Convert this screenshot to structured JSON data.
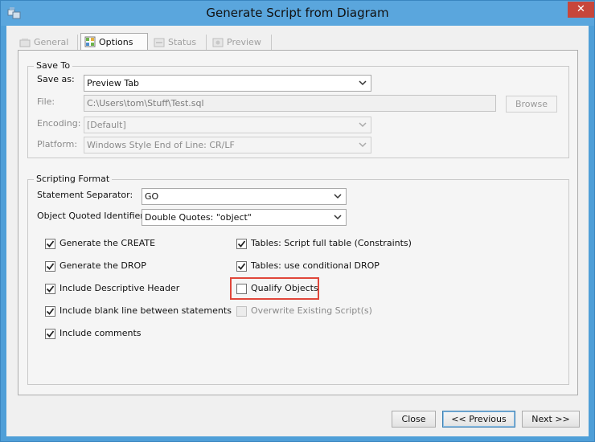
{
  "window": {
    "title": "Generate Script from Diagram",
    "close_glyph": "✕",
    "accent_color": "#5aa6dd"
  },
  "tabs": [
    {
      "label": "General",
      "icon": "general-icon",
      "active": false
    },
    {
      "label": "Options",
      "icon": "options-icon",
      "active": true
    },
    {
      "label": "Status",
      "icon": "status-icon",
      "active": false
    },
    {
      "label": "Preview",
      "icon": "preview-icon",
      "active": false
    }
  ],
  "save_to": {
    "legend": "Save To",
    "save_as_label": "Save as:",
    "save_as_value": "Preview Tab",
    "file_label": "File:",
    "file_value": "C:\\Users\\tom\\Stuff\\Test.sql",
    "browse_label": "Browse",
    "encoding_label": "Encoding:",
    "encoding_value": "[Default]",
    "platform_label": "Platform:",
    "platform_value": "Windows Style End of Line: CR/LF"
  },
  "scripting_format": {
    "legend": "Scripting Format",
    "separator_label": "Statement Separator:",
    "separator_value": "GO",
    "quoted_label": "Object Quoted Identifier:",
    "quoted_value": "Double Quotes: \"object\"",
    "left_checks": [
      {
        "label": "Generate the CREATE",
        "checked": true
      },
      {
        "label": "Generate the DROP",
        "checked": true
      },
      {
        "label": "Include Descriptive Header",
        "checked": true
      },
      {
        "label": "Include blank line between statements",
        "checked": true
      },
      {
        "label": "Include comments",
        "checked": true
      }
    ],
    "right_checks": [
      {
        "label": "Tables: Script full table (Constraints)",
        "checked": true,
        "enabled": true
      },
      {
        "label": "Tables: use conditional DROP",
        "checked": true,
        "enabled": true
      },
      {
        "label": "Qualify Objects",
        "checked": false,
        "enabled": true,
        "highlighted": true
      },
      {
        "label": "Overwrite Existing Script(s)",
        "checked": false,
        "enabled": false
      }
    ],
    "highlight_color": "#e0463a"
  },
  "footer": {
    "close_label": "Close",
    "previous_label": "<< Previous",
    "next_label": "Next >>"
  }
}
